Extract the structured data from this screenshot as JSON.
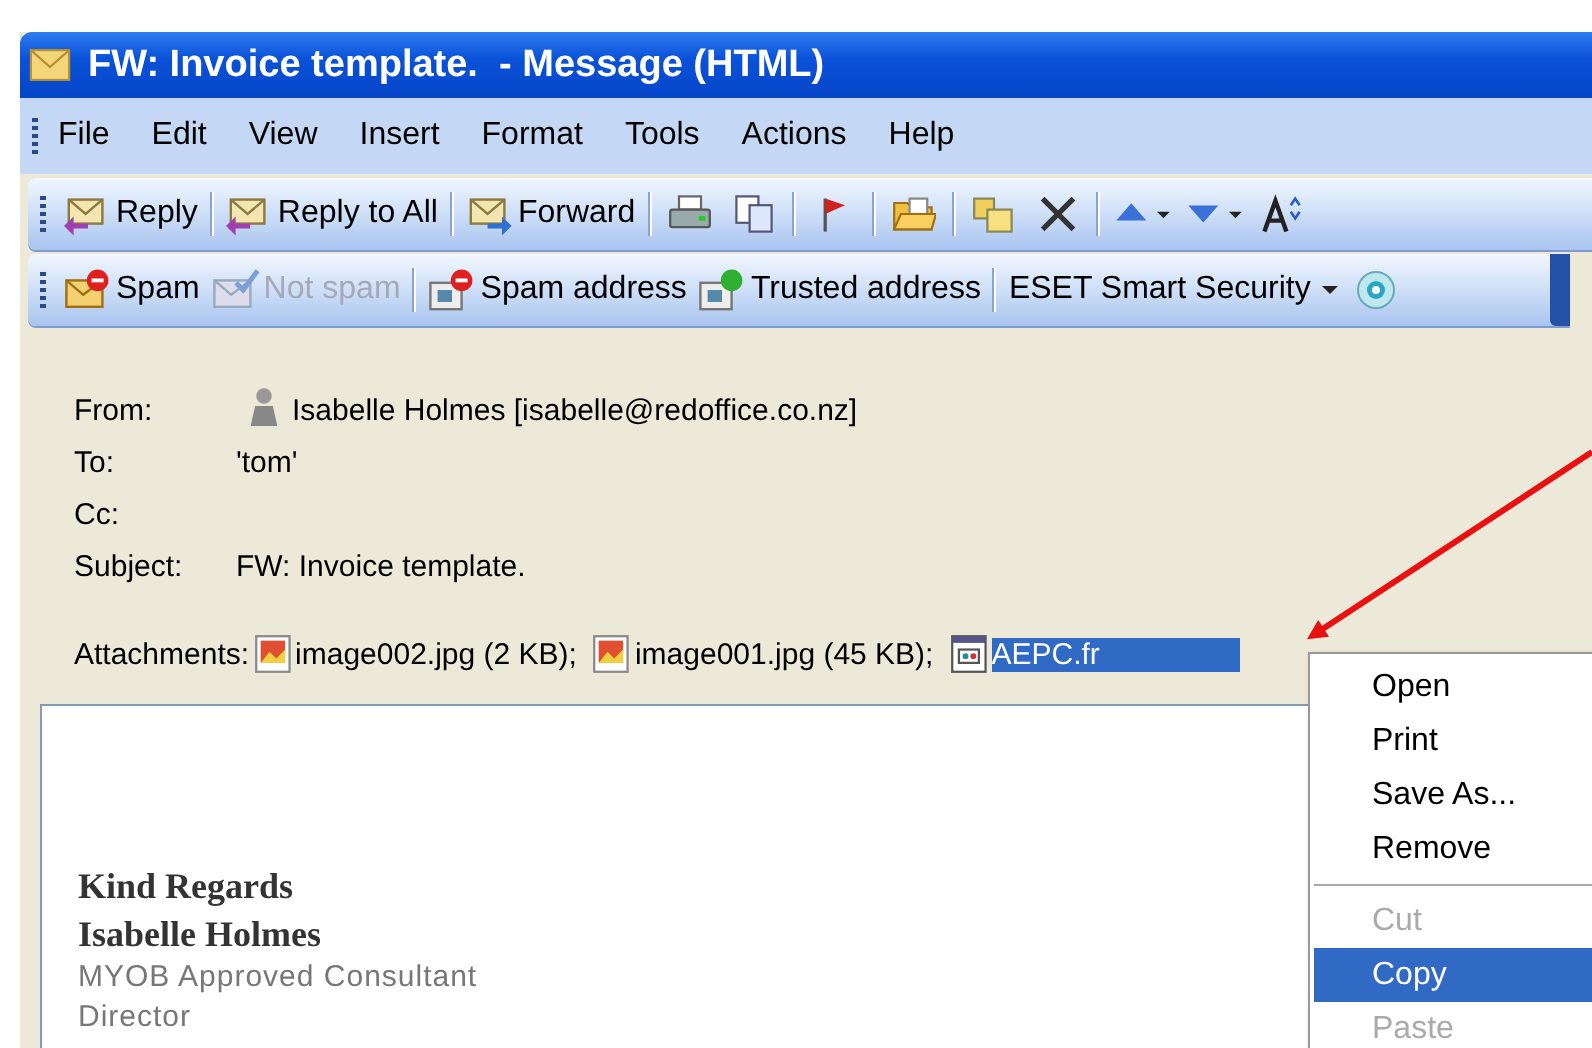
{
  "window": {
    "title": "FW: Invoice template.  - Message (HTML)"
  },
  "menu_bar": [
    "File",
    "Edit",
    "View",
    "Insert",
    "Format",
    "Tools",
    "Actions",
    "Help"
  ],
  "toolbar": [
    {
      "label": "Reply"
    },
    {
      "label": "Reply to All"
    },
    {
      "label": "Forward"
    }
  ],
  "spam_toolbar": [
    {
      "label": "Spam",
      "kind": "button",
      "disabled": false
    },
    {
      "label": "Not spam",
      "kind": "button",
      "disabled": true
    },
    {
      "label": "Spam address",
      "kind": "button",
      "disabled": false
    },
    {
      "label": "Trusted address",
      "kind": "button",
      "disabled": false
    },
    {
      "label": "ESET Smart Security",
      "kind": "dropdown",
      "disabled": false
    }
  ],
  "header": {
    "fields": [
      {
        "label": "From:",
        "value": "Isabelle Holmes [isabelle@redoffice.co.nz]"
      },
      {
        "label": "To:",
        "value": "'tom'"
      },
      {
        "label": "Cc:"
      },
      {
        "label": "Subject:",
        "value": "FW: Invoice template."
      }
    ],
    "attachments_label": "Attachments:",
    "attachments": [
      {
        "name": "image002.jpg (2 KB);",
        "kind": "image",
        "selected": false
      },
      {
        "name": "image001.jpg (45 KB);",
        "kind": "image",
        "selected": false
      },
      {
        "name": "AEPC.fr",
        "kind": "form",
        "selected": true
      }
    ]
  },
  "body": {
    "signature": [
      {
        "text": "Kind Regards",
        "kind": "heading"
      },
      {
        "text": "Isabelle Holmes",
        "kind": "heading"
      },
      {
        "text": "MYOB Approved Consultant",
        "kind": "line"
      },
      {
        "text": "Director",
        "kind": "line"
      }
    ]
  },
  "context_menu": [
    {
      "kind": "item",
      "label": "Open",
      "disabled": false,
      "selected": false
    },
    {
      "kind": "item",
      "label": "Print",
      "disabled": false,
      "selected": false
    },
    {
      "kind": "item",
      "label": "Save As...",
      "disabled": false,
      "selected": false
    },
    {
      "kind": "item",
      "label": "Remove",
      "disabled": false,
      "selected": false
    },
    {
      "kind": "separator"
    },
    {
      "kind": "item",
      "label": "Cut",
      "disabled": true,
      "selected": false
    },
    {
      "kind": "item",
      "label": "Copy",
      "disabled": false,
      "selected": true
    },
    {
      "kind": "item",
      "label": "Paste",
      "disabled": true,
      "selected": false
    }
  ]
}
